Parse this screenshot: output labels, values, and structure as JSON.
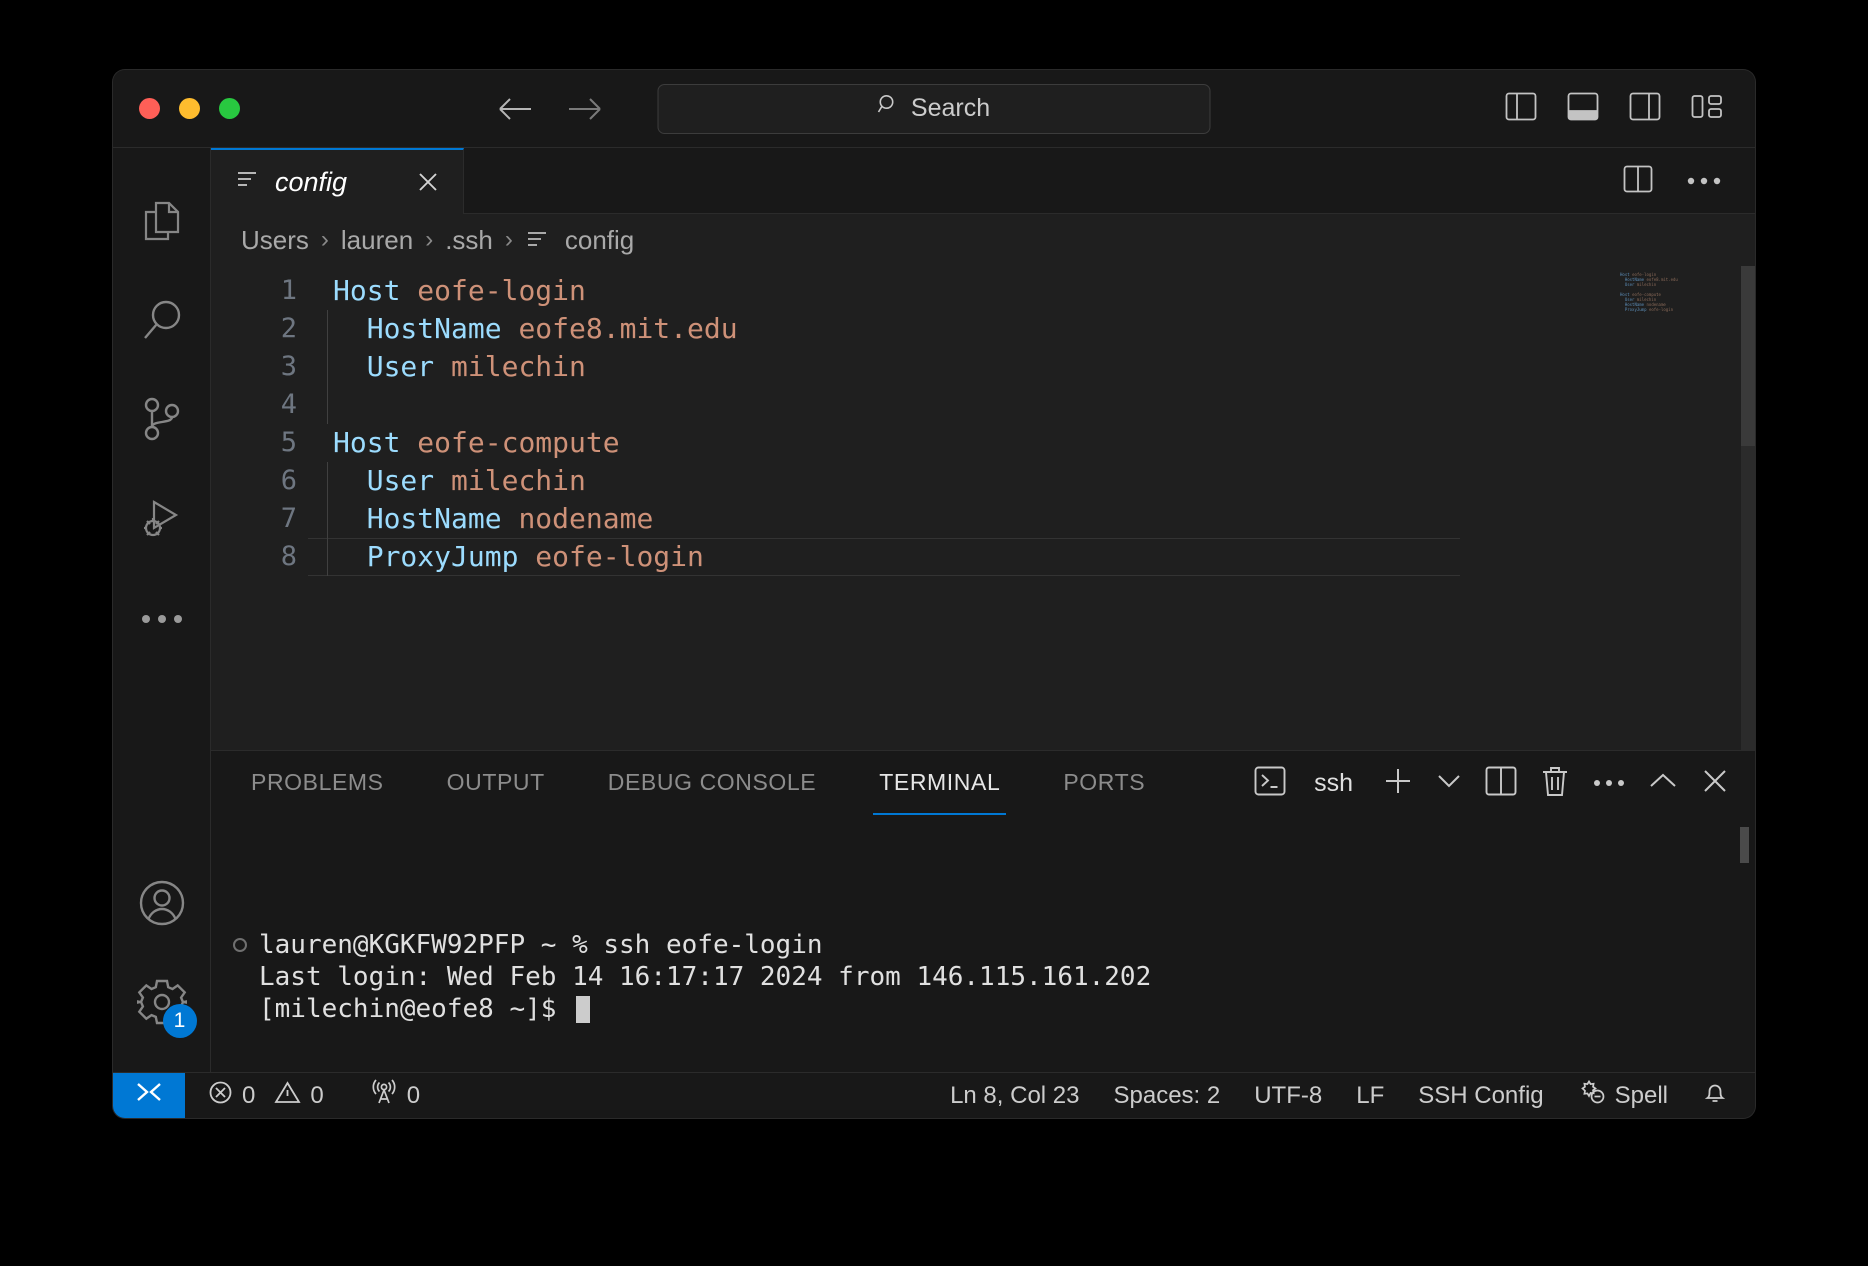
{
  "titlebar": {
    "back_icon": "arrow-left-icon",
    "forward_icon": "arrow-right-icon",
    "search_placeholder": "Search",
    "search_icon": "search-icon",
    "layout_icons": [
      "toggle-primary-sidebar-icon",
      "toggle-panel-icon",
      "toggle-secondary-sidebar-icon",
      "customize-layout-icon"
    ]
  },
  "activitybar": {
    "items": [
      {
        "name": "explorer",
        "icon": "files-icon"
      },
      {
        "name": "search",
        "icon": "search-icon"
      },
      {
        "name": "source-control",
        "icon": "source-control-icon"
      },
      {
        "name": "run-and-debug",
        "icon": "run-debug-icon"
      },
      {
        "name": "more",
        "icon": "ellipsis-icon"
      }
    ],
    "account_icon": "account-icon",
    "settings_icon": "gear-icon",
    "settings_badge": "1"
  },
  "tabs": [
    {
      "label": "config",
      "icon": "ssh-config-file-icon",
      "close_icon": "close-icon",
      "active": true,
      "preview": true
    }
  ],
  "editor_actions": {
    "split_icon": "split-editor-icon",
    "more_icon": "ellipsis-icon"
  },
  "breadcrumb": {
    "segments": [
      "Users",
      "lauren",
      ".ssh",
      "config"
    ],
    "separator": "›",
    "file_icon": "ssh-config-file-icon"
  },
  "code": {
    "language": "SSH Config",
    "lines": [
      {
        "num": "1",
        "indent": 0,
        "tokens": [
          {
            "t": "Host",
            "c": "kw"
          },
          {
            "t": " ",
            "c": "plain"
          },
          {
            "t": "eofe-login",
            "c": "val"
          }
        ]
      },
      {
        "num": "2",
        "indent": 1,
        "tokens": [
          {
            "t": "  ",
            "c": "plain"
          },
          {
            "t": "HostName",
            "c": "kw"
          },
          {
            "t": " ",
            "c": "plain"
          },
          {
            "t": "eofe8.mit.edu",
            "c": "val"
          }
        ]
      },
      {
        "num": "3",
        "indent": 1,
        "tokens": [
          {
            "t": "  ",
            "c": "plain"
          },
          {
            "t": "User",
            "c": "kw"
          },
          {
            "t": " ",
            "c": "plain"
          },
          {
            "t": "milechin",
            "c": "val"
          }
        ]
      },
      {
        "num": "4",
        "indent": 1,
        "tokens": []
      },
      {
        "num": "5",
        "indent": 0,
        "tokens": [
          {
            "t": "Host",
            "c": "kw"
          },
          {
            "t": " ",
            "c": "plain"
          },
          {
            "t": "eofe-compute",
            "c": "val"
          }
        ]
      },
      {
        "num": "6",
        "indent": 1,
        "tokens": [
          {
            "t": "  ",
            "c": "plain"
          },
          {
            "t": "User",
            "c": "kw"
          },
          {
            "t": " ",
            "c": "plain"
          },
          {
            "t": "milechin",
            "c": "val"
          }
        ]
      },
      {
        "num": "7",
        "indent": 1,
        "tokens": [
          {
            "t": "  ",
            "c": "plain"
          },
          {
            "t": "HostName",
            "c": "kw"
          },
          {
            "t": " ",
            "c": "plain"
          },
          {
            "t": "nodename",
            "c": "val"
          }
        ]
      },
      {
        "num": "8",
        "indent": 1,
        "active": true,
        "tokens": [
          {
            "t": "  ",
            "c": "plain"
          },
          {
            "t": "ProxyJump",
            "c": "kw"
          },
          {
            "t": " ",
            "c": "plain"
          },
          {
            "t": "eofe-login",
            "c": "val"
          }
        ]
      }
    ]
  },
  "panel": {
    "tabs": [
      {
        "label": "PROBLEMS",
        "active": false
      },
      {
        "label": "OUTPUT",
        "active": false
      },
      {
        "label": "DEBUG CONSOLE",
        "active": false
      },
      {
        "label": "TERMINAL",
        "active": true
      },
      {
        "label": "PORTS",
        "active": false
      }
    ],
    "actions": {
      "terminal_icon": "terminal-icon",
      "terminal_name": "ssh",
      "new_terminal_icon": "plus-icon",
      "dropdown_icon": "chevron-down-icon",
      "split_icon": "split-terminal-icon",
      "kill_icon": "trash-icon",
      "more_icon": "ellipsis-icon",
      "maximize_icon": "chevron-up-icon",
      "close_icon": "close-icon"
    }
  },
  "terminal": {
    "lines": [
      {
        "prompt_mark": true,
        "text": "lauren@KGKFW92PFP ~ % ssh eofe-login"
      },
      {
        "prompt_mark": false,
        "text": "Last login: Wed Feb 14 16:17:17 2024 from 146.115.161.202"
      },
      {
        "prompt_mark": false,
        "text": "[milechin@eofe8 ~]$ ",
        "cursor": true
      }
    ]
  },
  "statusbar": {
    "remote_icon": "remote-window-icon",
    "errors_icon": "error-icon",
    "errors": "0",
    "warnings_icon": "warning-icon",
    "warnings": "0",
    "ports_icon": "radio-tower-icon",
    "ports": "0",
    "cursor_position": "Ln 8, Col 23",
    "indentation": "Spaces: 2",
    "encoding": "UTF-8",
    "eol": "LF",
    "language": "SSH Config",
    "spell_icon": "spell-check-icon",
    "spell": "Spell",
    "bell_icon": "bell-icon"
  },
  "colors": {
    "accent": "#0078d4",
    "keyword": "#9cdcfe",
    "string": "#ce9178",
    "editor_bg": "#1f1f1f",
    "chrome_bg": "#181818"
  }
}
